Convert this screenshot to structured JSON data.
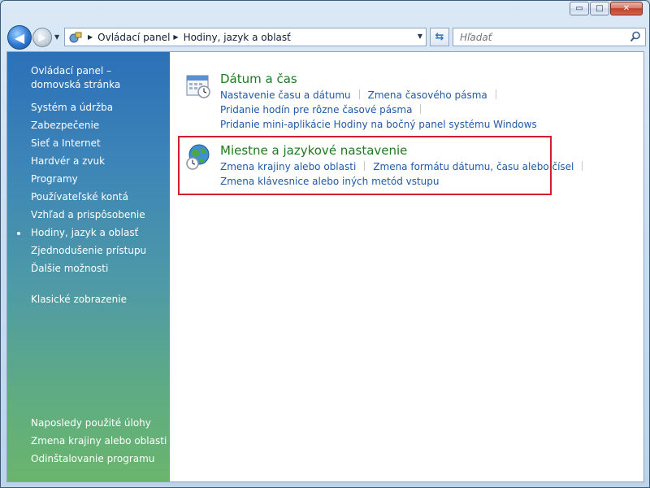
{
  "window": {
    "caption_buttons": {
      "minimize": "▭",
      "maximize": "□",
      "close": "✕"
    }
  },
  "nav": {
    "back_glyph": "◀",
    "forward_glyph": "▶",
    "breadcrumb": [
      "Ovládací panel",
      "Hodiny, jazyk a oblasť"
    ],
    "search_placeholder": "Hľadať"
  },
  "sidebar": {
    "home": "Ovládací panel – domovská stránka",
    "items": [
      "Systém a údržba",
      "Zabezpečenie",
      "Sieť a Internet",
      "Hardvér a zvuk",
      "Programy",
      "Používateľské kontá",
      "Vzhľad a prispôsobenie",
      "Hodiny, jazyk a oblasť",
      "Zjednodušenie prístupu",
      "Ďalšie možnosti"
    ],
    "active_index": 7,
    "classic_view": "Klasické zobrazenie",
    "recent_tasks_heading": "Naposledy použité úlohy",
    "recent_tasks": [
      "Zmena krajiny alebo oblasti",
      "Odinštalovanie programu"
    ]
  },
  "categories": [
    {
      "title": "Dátum a čas",
      "icon": "calendar-clock-icon",
      "links": [
        [
          "Nastavenie času a dátumu",
          "Zmena časového pásma"
        ],
        [
          "Pridanie hodín pre rôzne časové pásma"
        ],
        [
          "Pridanie mini-aplikácie Hodiny na bočný panel systému Windows"
        ]
      ]
    },
    {
      "title": "Miestne a jazykové nastavenie",
      "icon": "globe-clock-icon",
      "links": [
        [
          "Zmena krajiny alebo oblasti",
          "Zmena formátu dátumu, času alebo čísel"
        ],
        [
          "Zmena klávesnice alebo iných metód vstupu"
        ]
      ]
    }
  ],
  "colors": {
    "link": "#1e5aa8",
    "category_title": "#1e7a1e",
    "highlight_border": "#d21f2f"
  }
}
